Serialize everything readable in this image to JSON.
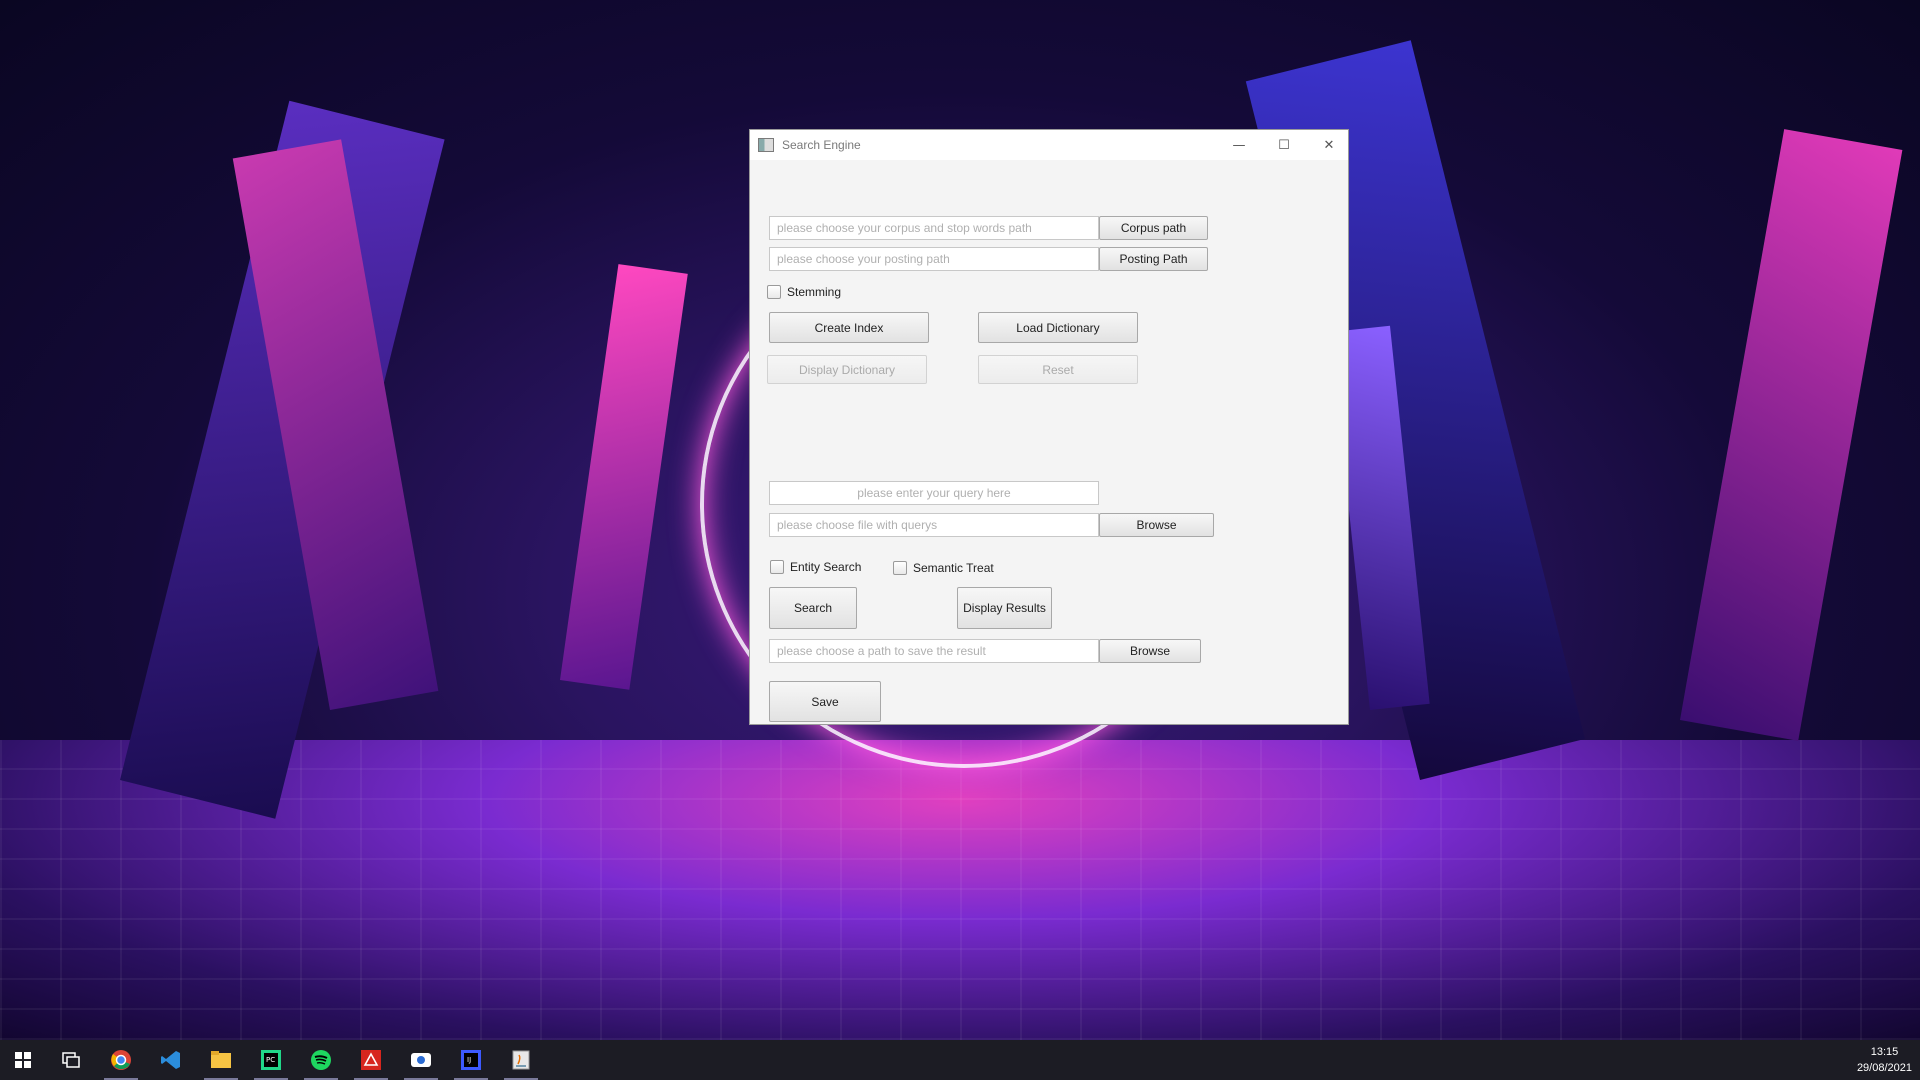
{
  "window": {
    "title": "Search Engine",
    "minimize_glyph": "—",
    "maximize_glyph": "☐",
    "close_glyph": "✕"
  },
  "corpus": {
    "placeholder": "please choose your corpus and stop words path",
    "button": "Corpus path"
  },
  "posting": {
    "placeholder": "please choose your posting path",
    "button": "Posting Path"
  },
  "stemming_label": "Stemming",
  "buttons": {
    "create_index": "Create Index",
    "load_dictionary": "Load Dictionary",
    "display_dictionary": "Display Dictionary",
    "reset": "Reset",
    "search": "Search",
    "display_results": "Display Results",
    "save": "Save"
  },
  "query": {
    "placeholder": "please enter your query here"
  },
  "query_file": {
    "placeholder": "please choose file with querys",
    "button": "Browse"
  },
  "entity_search_label": "Entity Search",
  "semantic_treat_label": "Semantic Treat",
  "save_path": {
    "placeholder": "please choose a path to save the result",
    "button": "Browse"
  },
  "taskbar": {
    "icons": [
      "windows-start-icon",
      "task-view-icon",
      "chrome-icon",
      "vscode-icon",
      "file-explorer-icon",
      "pycharm-icon",
      "spotify-icon",
      "acrobat-icon",
      "screen-capture-icon",
      "intellij-icon",
      "java-app-icon"
    ],
    "time": "13:15",
    "date": "29/08/2021"
  }
}
